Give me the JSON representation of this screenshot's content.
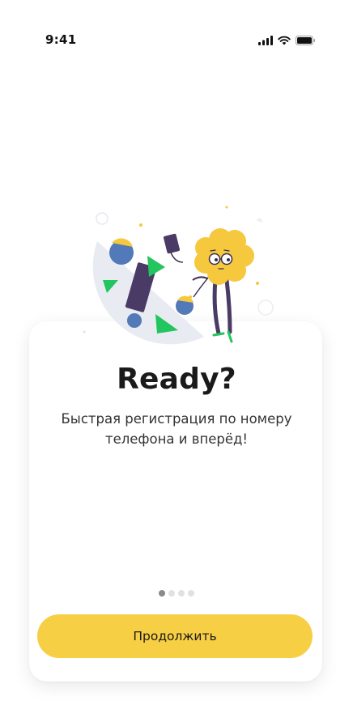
{
  "status_bar": {
    "time": "9:41",
    "icons": [
      "cellular-signal-icon",
      "wifi-icon",
      "battery-icon"
    ]
  },
  "illustration": {
    "name": "character-with-shapes-illustration"
  },
  "onboarding": {
    "title": "Ready?",
    "subtitle": "Быстрая регистрация по номеру телефона и вперёд!",
    "pages_total": 4,
    "active_page": 1,
    "continue_label": "Продолжить"
  },
  "colors": {
    "accent": "#f7cf44",
    "card_background": "#ffffff",
    "character_yellow": "#f5c83e",
    "shape_blue": "#5279b8",
    "shape_green": "#22c55e",
    "shape_purple": "#4a3a66"
  }
}
